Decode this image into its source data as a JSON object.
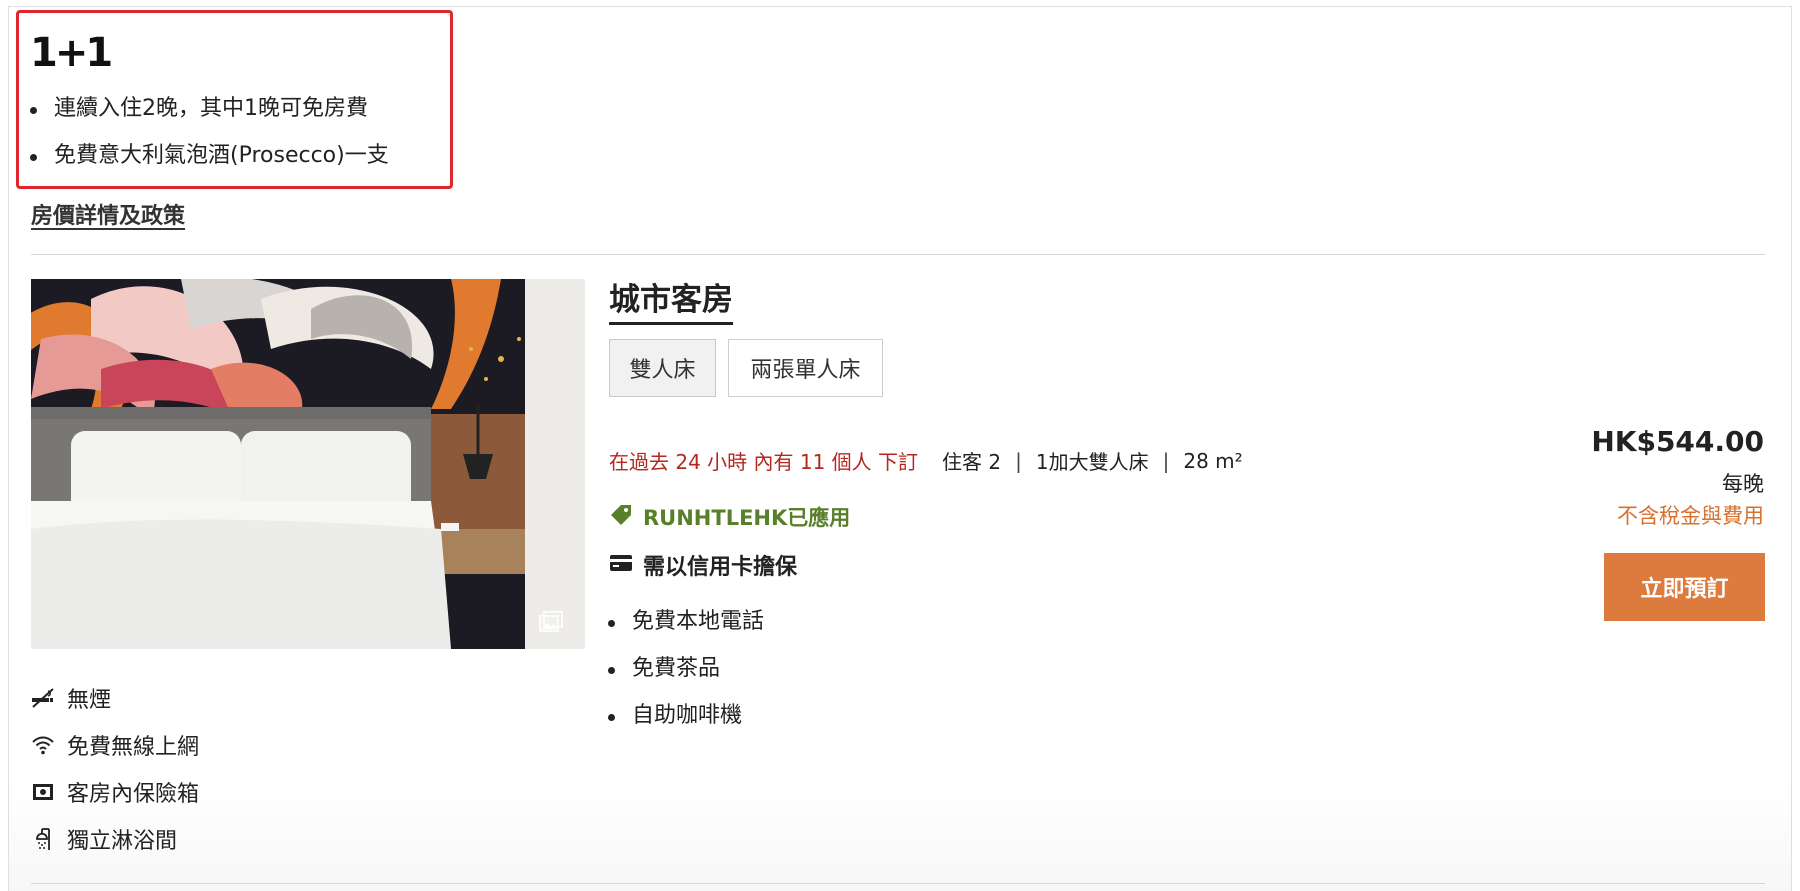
{
  "offer": {
    "title": "1+1",
    "items": [
      "連續入住2晚，其中1晚可免房費",
      "免費意大利氣泡酒(Prosecco)一支"
    ]
  },
  "policy_link": "房價詳情及政策",
  "room": {
    "name": "城市客房",
    "bed_options": [
      {
        "label": "雙人床",
        "selected": true
      },
      {
        "label": "兩張單人床",
        "selected": false
      }
    ],
    "booked_notice": "在過去 24 小時 內有 11 個人 下訂",
    "guests": "住客 2",
    "bed_spec": "1加大雙人床",
    "size": "28 m²",
    "promo_code": "RUNHTLEHK已應用",
    "credit_note": "需以信用卡擔保",
    "amenities": [
      "免費本地電話",
      "免費茶品",
      "自助咖啡機"
    ],
    "features": [
      {
        "icon": "no-smoking-icon",
        "label": "無煙"
      },
      {
        "icon": "wifi-icon",
        "label": "免費無線上網"
      },
      {
        "icon": "safe-icon",
        "label": "客房內保險箱"
      },
      {
        "icon": "shower-icon",
        "label": "獨立淋浴間"
      }
    ]
  },
  "price": {
    "amount": "HK$544.00",
    "per": "每晚",
    "tax_note": "不含稅金與費用"
  },
  "book_button": "立即預訂",
  "colors": {
    "highlight_border": "#e0262c",
    "booked_text": "#b5271f",
    "promo_text": "#5a7f2b",
    "tax_note": "#d8702e",
    "book_button": "#dd7a3e"
  }
}
